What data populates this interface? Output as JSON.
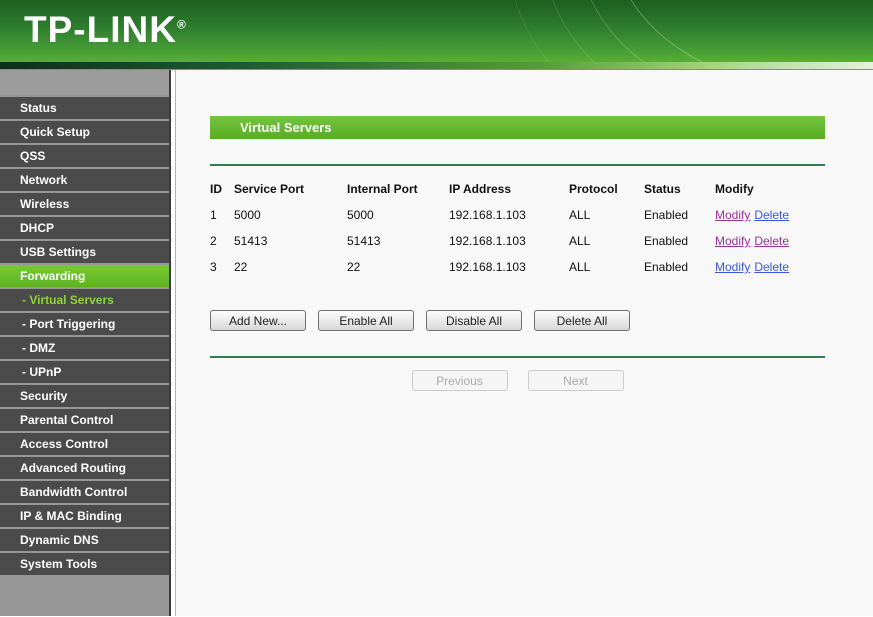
{
  "header": {
    "logo_text": "TP-LINK",
    "registered_mark": "®"
  },
  "sidebar": {
    "items": [
      {
        "label": "Status",
        "type": "item",
        "active": false
      },
      {
        "label": "Quick Setup",
        "type": "item",
        "active": false
      },
      {
        "label": "QSS",
        "type": "item",
        "active": false
      },
      {
        "label": "Network",
        "type": "item",
        "active": false
      },
      {
        "label": "Wireless",
        "type": "item",
        "active": false
      },
      {
        "label": "DHCP",
        "type": "item",
        "active": false
      },
      {
        "label": "USB Settings",
        "type": "item",
        "active": false
      },
      {
        "label": "Forwarding",
        "type": "item",
        "active": true
      },
      {
        "label": "- Virtual Servers",
        "type": "subitem",
        "active": true
      },
      {
        "label": "- Port Triggering",
        "type": "subitem",
        "active": false
      },
      {
        "label": "- DMZ",
        "type": "subitem",
        "active": false
      },
      {
        "label": "- UPnP",
        "type": "subitem",
        "active": false
      },
      {
        "label": "Security",
        "type": "item",
        "active": false
      },
      {
        "label": "Parental Control",
        "type": "item",
        "active": false
      },
      {
        "label": "Access Control",
        "type": "item",
        "active": false
      },
      {
        "label": "Advanced Routing",
        "type": "item",
        "active": false
      },
      {
        "label": "Bandwidth Control",
        "type": "item",
        "active": false
      },
      {
        "label": "IP & MAC Binding",
        "type": "item",
        "active": false
      },
      {
        "label": "Dynamic DNS",
        "type": "item",
        "active": false
      },
      {
        "label": "System Tools",
        "type": "item",
        "active": false
      }
    ]
  },
  "main": {
    "title": "Virtual Servers",
    "table": {
      "columns": [
        "ID",
        "Service Port",
        "Internal Port",
        "IP Address",
        "Protocol",
        "Status",
        "Modify"
      ],
      "rows": [
        {
          "id": "1",
          "service_port": "5000",
          "internal_port": "5000",
          "ip_address": "192.168.1.103",
          "protocol": "ALL",
          "status": "Enabled",
          "modify_label": "Modify",
          "delete_label": "Delete",
          "modify_visited": true,
          "delete_visited": false
        },
        {
          "id": "2",
          "service_port": "51413",
          "internal_port": "51413",
          "ip_address": "192.168.1.103",
          "protocol": "ALL",
          "status": "Enabled",
          "modify_label": "Modify",
          "delete_label": "Delete",
          "modify_visited": true,
          "delete_visited": true
        },
        {
          "id": "3",
          "service_port": "22",
          "internal_port": "22",
          "ip_address": "192.168.1.103",
          "protocol": "ALL",
          "status": "Enabled",
          "modify_label": "Modify",
          "delete_label": "Delete",
          "modify_visited": false,
          "delete_visited": false
        }
      ]
    },
    "buttons": [
      {
        "label": "Add New...",
        "name": "add-new-button"
      },
      {
        "label": "Enable All",
        "name": "enable-all-button"
      },
      {
        "label": "Disable All",
        "name": "disable-all-button"
      },
      {
        "label": "Delete All",
        "name": "delete-all-button"
      }
    ],
    "pagination": {
      "previous_label": "Previous",
      "next_label": "Next"
    }
  },
  "colors": {
    "header_green_top": "#1c5e20",
    "header_green_bottom": "#58ae31",
    "active_menu_green": "#6cc327",
    "title_bar_green": "#5fb52a",
    "separator_green": "#2e7d4c",
    "link_blue": "#3a56dd",
    "link_visited_purple": "#993399",
    "sidebar_item_gray": "#4b4b4b"
  }
}
